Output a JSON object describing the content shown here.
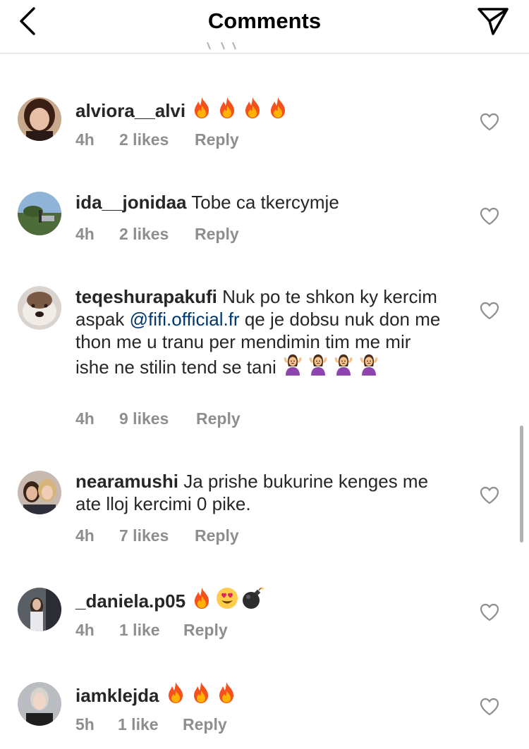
{
  "header": {
    "title": "Comments",
    "back_icon": "chevron-left-icon",
    "send_icon": "paper-plane-icon"
  },
  "colors": {
    "text": "#262626",
    "secondary": "#8e8e8e",
    "mention": "#00376b",
    "divider": "#dbdbdb"
  },
  "comments": [
    {
      "username": "alviora__alvi",
      "text": "",
      "emojis": [
        "fire",
        "fire",
        "fire",
        "fire"
      ],
      "time": "4h",
      "likes": "2 likes",
      "reply": "Reply"
    },
    {
      "username": "ida__jonidaa",
      "text": "Tobe ca tkercymje",
      "emojis": [],
      "time": "4h",
      "likes": "2 likes",
      "reply": "Reply"
    },
    {
      "username": "teqeshurapakufi",
      "text_before": "Nuk po te shkon ky kercim aspak",
      "mention": "@fifi.official.fr",
      "text_after": "qe je dobsu nuk don me thon me u tranu per mendimin tim me mir ishe ne stilin tend se tani",
      "emojis": [
        "woman-shrugging",
        "woman-shrugging",
        "woman-shrugging",
        "woman-shrugging"
      ],
      "time": "4h",
      "likes": "9 likes",
      "reply": "Reply"
    },
    {
      "username": "nearamushi",
      "text": "Ja prishe bukurine kenges me ate lloj kercimi 0 pike.",
      "emojis": [],
      "time": "4h",
      "likes": "7 likes",
      "reply": "Reply"
    },
    {
      "username": "_daniela.p05",
      "text": "",
      "emojis": [
        "fire",
        "heart-eyes",
        "bomb"
      ],
      "time": "4h",
      "likes": "1 like",
      "reply": "Reply"
    },
    {
      "username": "iamklejda",
      "text": "",
      "emojis": [
        "fire",
        "fire",
        "fire"
      ],
      "time": "5h",
      "likes": "1 like",
      "reply": "Reply"
    }
  ]
}
